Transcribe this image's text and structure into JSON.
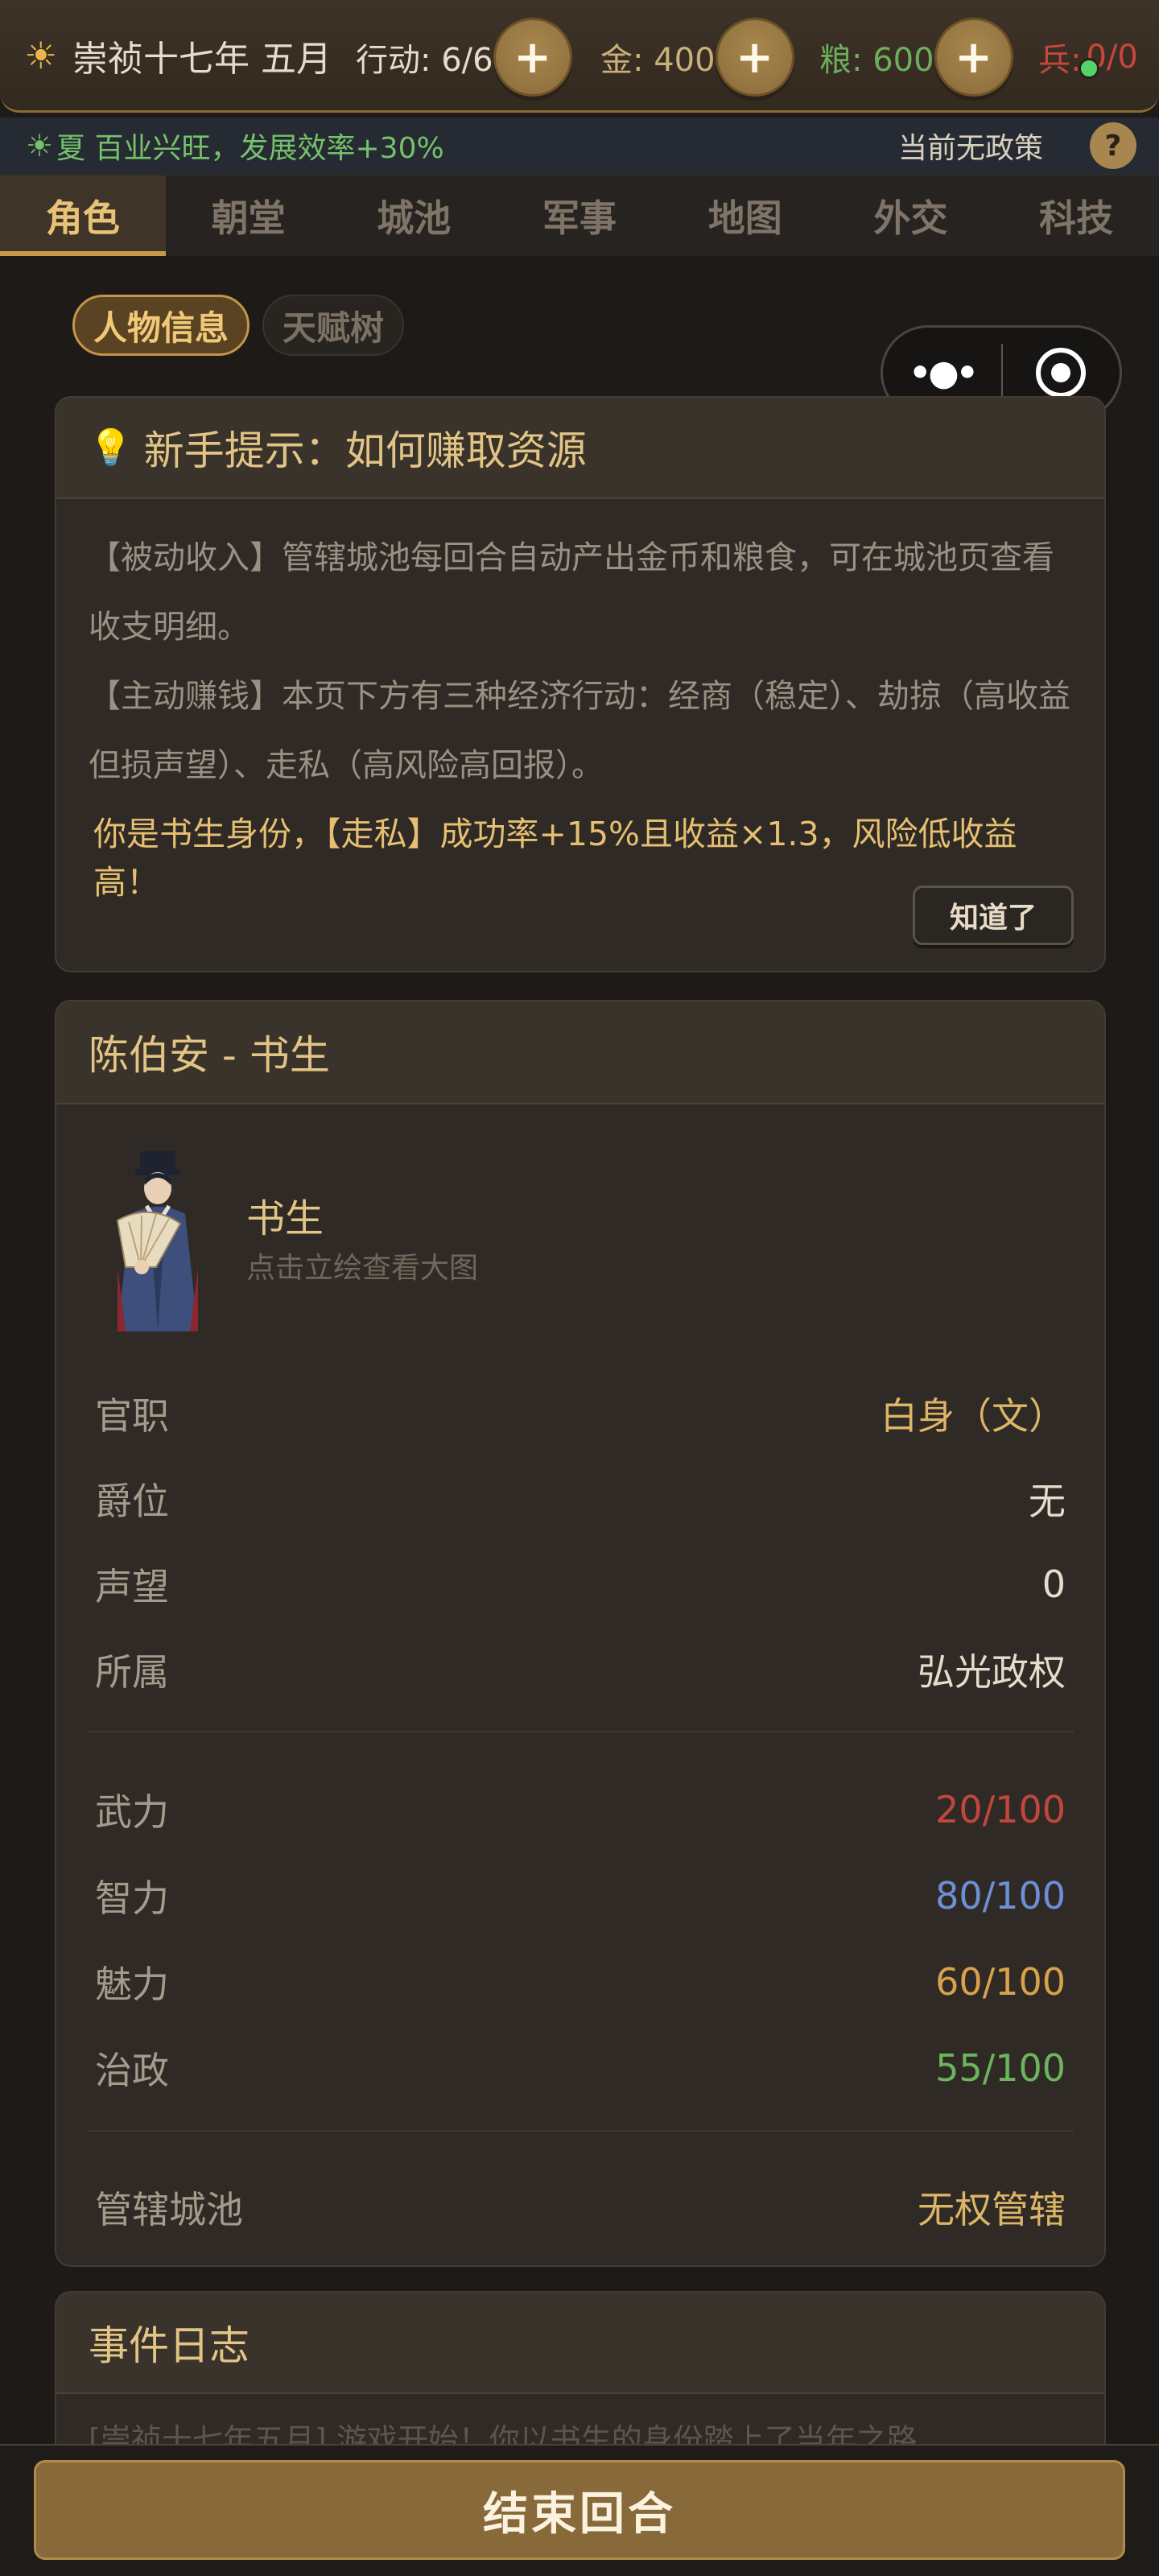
{
  "topbar": {
    "date": "崇祯十七年 五月",
    "action": "行动: 6/6",
    "gold": "金: 400",
    "food": "粮: 600",
    "soldier_prefix": "兵:",
    "soldier_value": "0/0",
    "plus_label": "+"
  },
  "season": {
    "text": "夏 百业兴旺，发展效率+30%",
    "policy": "当前无政策",
    "help": "?"
  },
  "tabs": [
    "角色",
    "朝堂",
    "城池",
    "军事",
    "地图",
    "外交",
    "科技"
  ],
  "subtabs": [
    "人物信息",
    "天赋树"
  ],
  "tip": {
    "title": "新手提示：如何赚取资源",
    "para1": "【被动收入】管辖城池每回合自动产出金币和粮食，可在城池页查看收支明细。",
    "para2": "【主动赚钱】本页下方有三种经济行动：经商（稳定）、劫掠（高收益但损声望）、走私（高风险高回报）。",
    "highlight": "你是书生身份，【走私】成功率+15%且收益×1.3，风险低收益高！",
    "ok": "知道了"
  },
  "character": {
    "title": "陈伯安 - 书生",
    "role": "书生",
    "hint": "点击立绘查看大图",
    "info": [
      {
        "k": "官职",
        "v": "白身（文）"
      },
      {
        "k": "爵位",
        "v": "无"
      },
      {
        "k": "声望",
        "v": "0"
      },
      {
        "k": "所属",
        "v": "弘光政权"
      }
    ],
    "stats": [
      {
        "k": "武力",
        "v": "20/100",
        "color": "#c1473c"
      },
      {
        "k": "智力",
        "v": "80/100",
        "color": "#6d8fd6"
      },
      {
        "k": "魅力",
        "v": "60/100",
        "color": "#d9a14c"
      },
      {
        "k": "治政",
        "v": "55/100",
        "color": "#6cb55c"
      }
    ],
    "city": {
      "k": "管辖城池",
      "v": "无权管辖"
    }
  },
  "log": {
    "title": "事件日志",
    "preview": "[崇祯十七年五月] 游戏开始！你以书生的身份踏上了当年之路…"
  },
  "end_turn": "结束回合"
}
